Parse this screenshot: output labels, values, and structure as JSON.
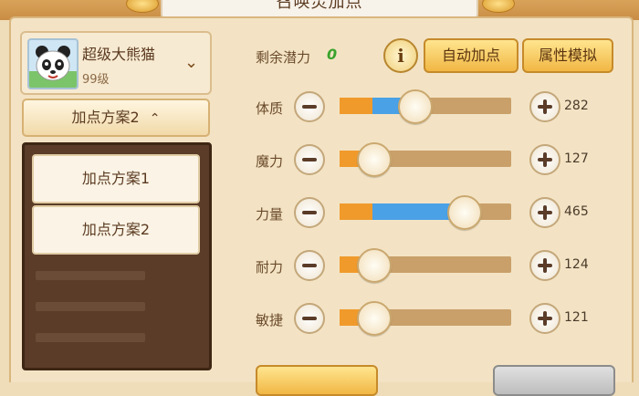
{
  "window": {
    "title": "召唤灵加点"
  },
  "pet": {
    "name": "超级大熊猫",
    "level": "99级"
  },
  "scheme": {
    "current_label": "加点方案2",
    "options": [
      "加点方案1",
      "加点方案2"
    ]
  },
  "potential": {
    "label": "剩余潜力",
    "value": "0"
  },
  "buttons": {
    "auto_assign": "自动加点",
    "simulate": "属性模拟"
  },
  "stats": [
    {
      "label": "体质",
      "value": "282",
      "base_pct": 0.19,
      "added_pct": 0.43
    },
    {
      "label": "魔力",
      "value": "127",
      "base_pct": 0.19,
      "added_pct": 0.19
    },
    {
      "label": "力量",
      "value": "465",
      "base_pct": 0.19,
      "added_pct": 0.72
    },
    {
      "label": "耐力",
      "value": "124",
      "base_pct": 0.19,
      "added_pct": 0.19
    },
    {
      "label": "敏捷",
      "value": "121",
      "base_pct": 0.19,
      "added_pct": 0.19
    }
  ],
  "colors": {
    "base_fill": "#f09a2c",
    "added_fill": "#4aa1e6",
    "track": "#c9a06a",
    "potential": "#3aa32c"
  }
}
